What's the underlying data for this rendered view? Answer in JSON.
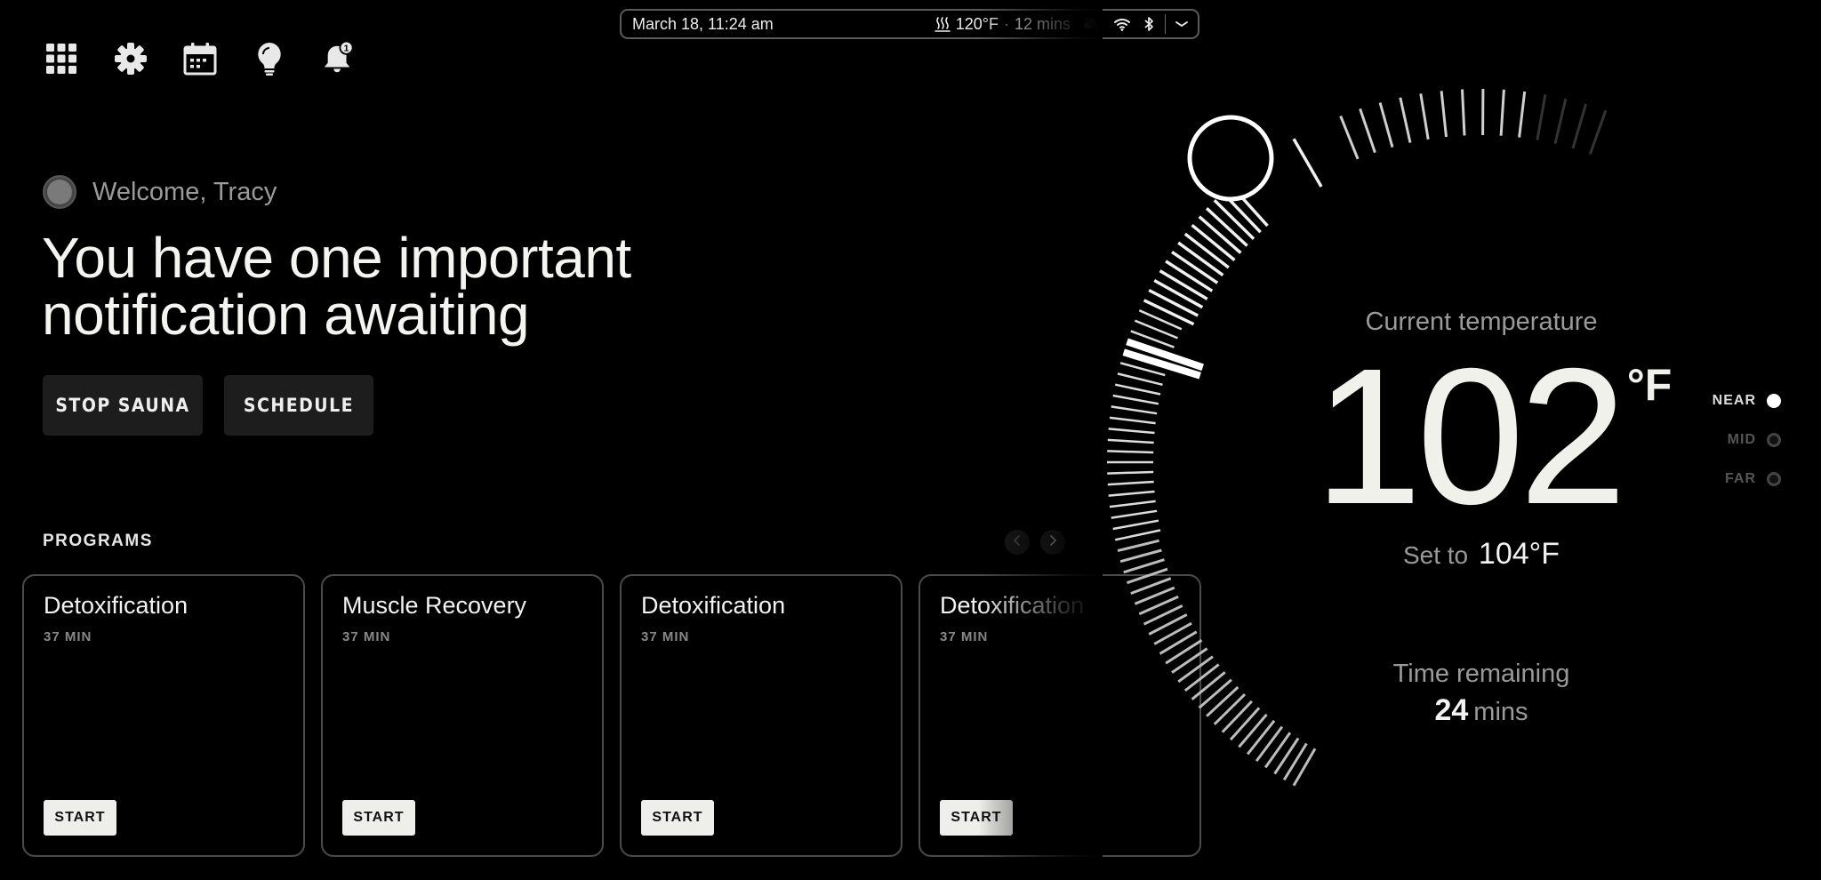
{
  "status_bar": {
    "datetime": "March 18, 11:24 am",
    "heat_temp": "120°F",
    "separator": "·",
    "duration": "12 mins",
    "icons": [
      "heat-icon",
      "cloud-off-icon",
      "wifi-icon",
      "bluetooth-icon",
      "chevron-down-icon"
    ]
  },
  "top_nav": {
    "icons": [
      "apps-grid-icon",
      "gear-icon",
      "calendar-icon",
      "lightbulb-icon",
      "bell-icon"
    ],
    "notification_count": "1"
  },
  "welcome": {
    "text": "Welcome, Tracy"
  },
  "headline": "You have one important notification awaiting",
  "actions": {
    "stop_label": "STOP SAUNA",
    "schedule_label": "SCHEDULE"
  },
  "programs": {
    "heading": "PROGRAMS",
    "items": [
      {
        "title": "Detoxification",
        "duration": "37 MIN",
        "start_label": "START"
      },
      {
        "title": "Muscle Recovery",
        "duration": "37 MIN",
        "start_label": "START"
      },
      {
        "title": "Detoxification",
        "duration": "37 MIN",
        "start_label": "START"
      },
      {
        "title": "Detoxification",
        "duration": "37 MIN",
        "start_label": "START"
      }
    ]
  },
  "temperature": {
    "current_label": "Current temperature",
    "current_value": "102",
    "unit": "°F",
    "set_prefix": "Set to",
    "set_value": "104°F",
    "remaining_label": "Time remaining",
    "remaining_value": "24",
    "remaining_unit": "mins"
  },
  "distance": {
    "options": [
      "NEAR",
      "MID",
      "FAR"
    ],
    "selected": "NEAR"
  },
  "colors": {
    "background": "#000000",
    "accent": "#f1f1ec",
    "muted": "#9a9a9a"
  }
}
